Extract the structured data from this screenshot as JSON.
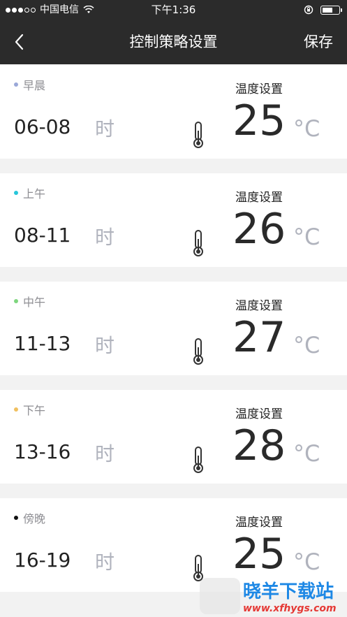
{
  "status_bar": {
    "carrier": "中国电信",
    "time": "下午1:36"
  },
  "nav": {
    "title": "控制策略设置",
    "save_label": "保存"
  },
  "temp_label": "温度设置",
  "hour_unit": "时",
  "temp_unit": "°C",
  "periods": [
    {
      "name": "早晨",
      "hours": "06-08",
      "temperature": "25",
      "dot_color": "#9aa8d8"
    },
    {
      "name": "上午",
      "hours": "08-11",
      "temperature": "26",
      "dot_color": "#26c6da"
    },
    {
      "name": "中午",
      "hours": "11-13",
      "temperature": "27",
      "dot_color": "#7ed67e"
    },
    {
      "name": "下午",
      "hours": "13-16",
      "temperature": "28",
      "dot_color": "#f0c060"
    },
    {
      "name": "傍晚",
      "hours": "16-19",
      "temperature": "25",
      "dot_color": "#111111"
    }
  ],
  "watermark": {
    "title": "晓羊下载站",
    "url": "www.xfhygs.com"
  }
}
